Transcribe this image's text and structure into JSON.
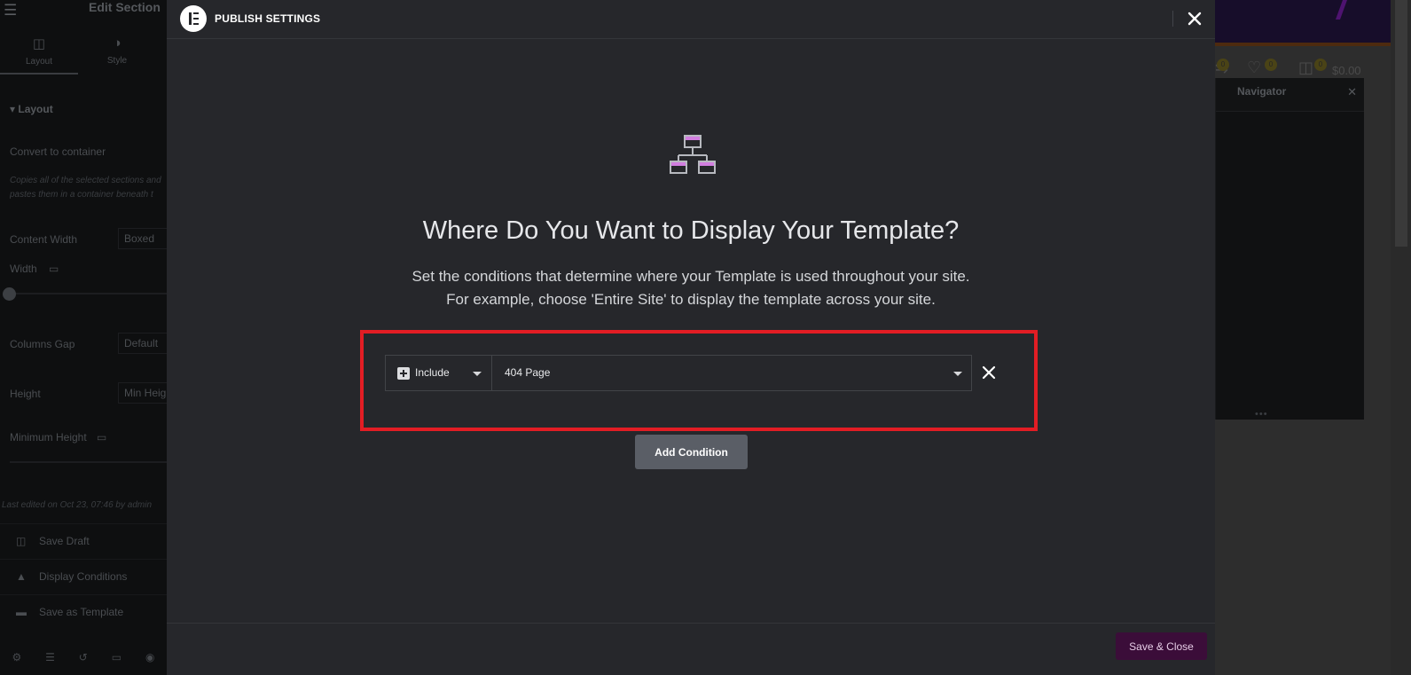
{
  "editor": {
    "title": "Edit Section",
    "tabs": [
      {
        "label": "Layout",
        "icon": "layout-icon"
      },
      {
        "label": "Style",
        "icon": "style-icon"
      }
    ],
    "section_title": "Layout",
    "convert_label": "Convert to container",
    "convert_desc_1": "Copies all of the selected sections and",
    "convert_desc_2": "pastes them in a container beneath t",
    "content_width_label": "Content Width",
    "content_width_value": "Boxed",
    "width_label": "Width",
    "columns_gap_label": "Columns Gap",
    "columns_gap_value": "Default",
    "height_label": "Height",
    "height_value": "Min Heigh",
    "min_height_label": "Minimum Height",
    "last_edited": "Last edited on Oct 23, 07:46 by admin",
    "actions": [
      "Save Draft",
      "Display Conditions",
      "Save as Template"
    ]
  },
  "preview": {
    "price": "$0.00",
    "badge_count": "0",
    "navigator_title": "Navigator"
  },
  "modal": {
    "title": "PUBLISH SETTINGS",
    "heading": "Where Do You Want to Display Your Template?",
    "desc_line1": "Set the conditions that determine where your Template is used throughout your site.",
    "desc_line2": "For example, choose 'Entire Site' to display the template across your site.",
    "condition": {
      "type": "Include",
      "value": "404 Page"
    },
    "add_condition_label": "Add Condition",
    "save_close_label": "Save & Close"
  },
  "colors": {
    "accent_highlight": "#e21d24",
    "save_button": "#3b0d39",
    "icon_accent": "#d27ee0"
  }
}
